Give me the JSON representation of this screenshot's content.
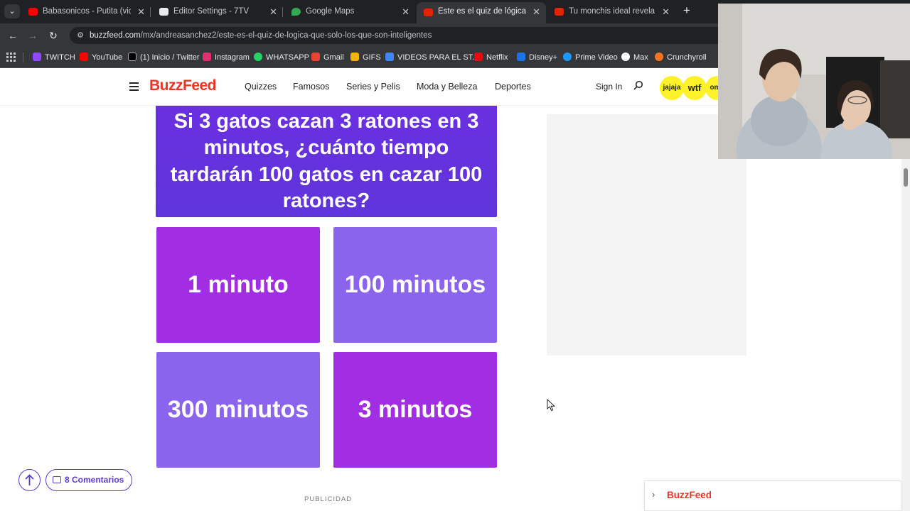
{
  "browser": {
    "tabs": [
      {
        "title": "Babasonicos - Putita (video of",
        "favicon_color": "#ff0000"
      },
      {
        "title": "Editor Settings - 7TV",
        "favicon_color": "#e8eaed"
      },
      {
        "title": "Google Maps",
        "favicon_color": "#34a853"
      },
      {
        "title": "Este es el quiz de lógica que so",
        "favicon_color": "#e32400",
        "active": true
      },
      {
        "title": "Tu monchis ideal revela si ga",
        "favicon_color": "#e32400"
      }
    ],
    "close_glyph": "✕",
    "new_tab_glyph": "+",
    "url_host": "buzzfeed.com",
    "url_path": "/mx/andreasanchez2/este-es-el-quiz-de-logica-que-solo-los-que-son-inteligentes",
    "bookmarks": [
      {
        "label": "TWITCH",
        "color": "#9146ff"
      },
      {
        "label": "YouTube",
        "color": "#ff0000"
      },
      {
        "label": "(1) Inicio / Twitter",
        "color": "#000000"
      },
      {
        "label": "Instagram",
        "color": "#e1306c"
      },
      {
        "label": "WHATSAPP",
        "color": "#25d366"
      },
      {
        "label": "Gmail",
        "color": "#ea4335"
      },
      {
        "label": "GIFS",
        "color": "#f4b400"
      },
      {
        "label": "VIDEOS PARA EL ST...",
        "color": "#4285f4"
      },
      {
        "label": "Netflix",
        "color": "#e50914"
      },
      {
        "label": "Disney+",
        "color": "#1a73e8"
      },
      {
        "label": "Prime Video",
        "color": "#1a98ff"
      },
      {
        "label": "Max",
        "color": "#ffffff"
      },
      {
        "label": "Crunchyroll",
        "color": "#f47521"
      }
    ]
  },
  "site": {
    "logo": "BuzzFeed",
    "nav": [
      "Quizzes",
      "Famosos",
      "Series y Pelis",
      "Moda y Belleza",
      "Deportes"
    ],
    "sign_in": "Sign In",
    "badges": [
      "jajaja",
      "wtf",
      "omg"
    ],
    "brand_color": "#ee3322"
  },
  "quiz": {
    "question": "Si 3 gatos cazan 3 ratones en 3 minutos, ¿cuánto tiempo tardarán 100 gatos en cazar 100 ratones?",
    "answers": [
      "1 minuto",
      "100 minutos",
      "300 minutos",
      "3 minutos"
    ],
    "colors": {
      "question": "#6633dd",
      "magenta": "#a22ee3",
      "lavender": "#8b64ee"
    }
  },
  "footer": {
    "publicidad": "PUBLICIDAD",
    "comments": "8 Comentarios",
    "widget_logo": "BuzzFeed"
  }
}
